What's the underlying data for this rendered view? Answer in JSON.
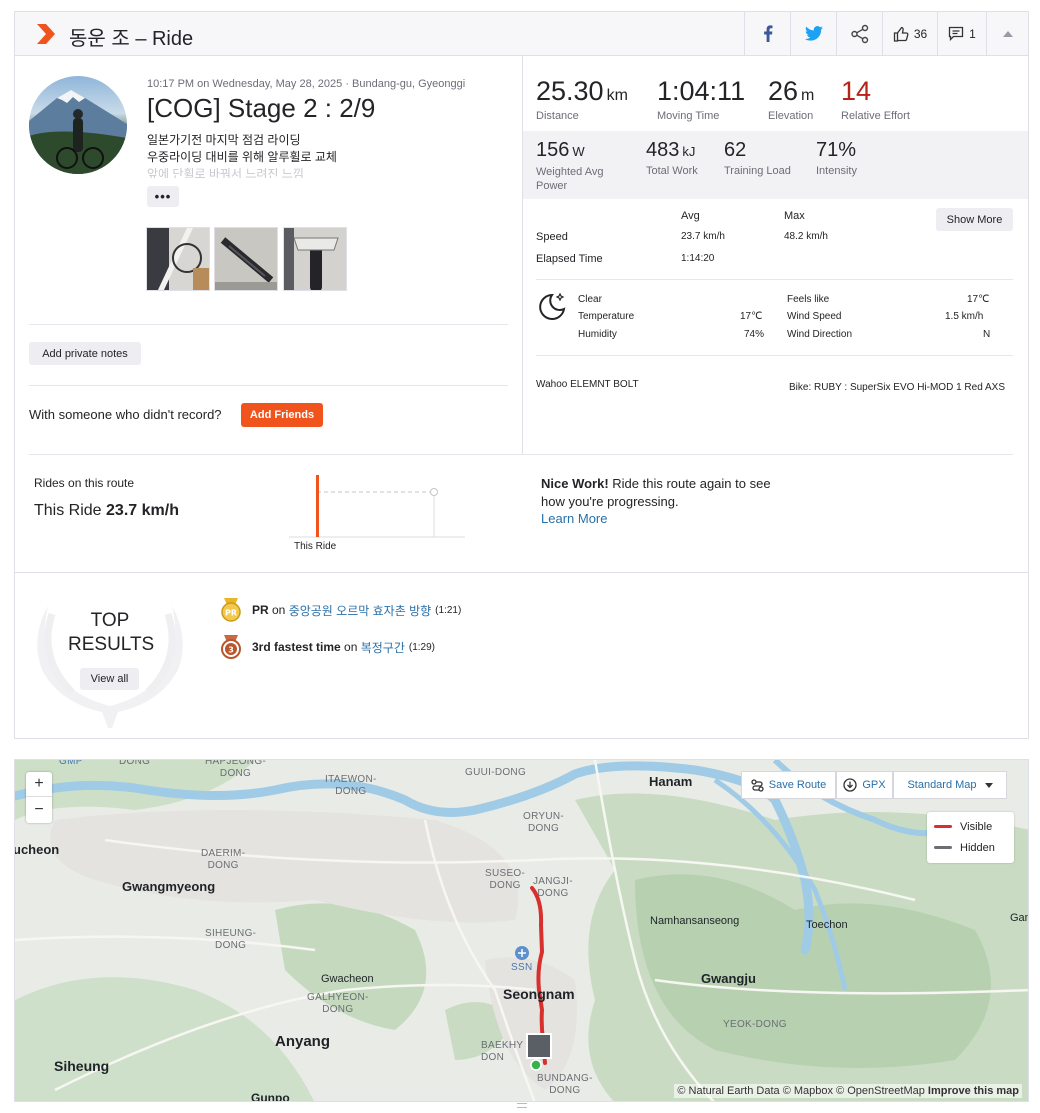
{
  "header": {
    "title": "동운 조 – Ride",
    "kudos_count": "36",
    "comments_count": "1"
  },
  "activity": {
    "meta": "10:17 PM on Wednesday, May 28, 2025 · Bundang-gu, Gyeonggi",
    "title": "[COG] Stage 2 : 2/9",
    "description_lines": [
      "일본가기전 마지막 점검 라이딩",
      "우중라이딩 대비를 위해 알루휠로 교체",
      "앞에 단휠로 바꿔서 느려진 느낌"
    ],
    "more_label": "•••",
    "add_notes_label": "Add private notes",
    "friends_prompt": "With someone who didn't record?",
    "add_friends_label": "Add Friends"
  },
  "stats_primary": [
    {
      "value": "25.30",
      "unit": "km",
      "label": "Distance"
    },
    {
      "value": "1:04:11",
      "unit": "",
      "label": "Moving Time"
    },
    {
      "value": "26",
      "unit": "m",
      "label": "Elevation"
    },
    {
      "value": "14",
      "unit": "",
      "label": "Relative Effort"
    }
  ],
  "stats_secondary": [
    {
      "value": "156",
      "unit": "W",
      "label": "Weighted Avg Power"
    },
    {
      "value": "483",
      "unit": "kJ",
      "label": "Total Work"
    },
    {
      "value": "62",
      "unit": "",
      "label": "Training Load"
    },
    {
      "value": "71%",
      "unit": "",
      "label": "Intensity"
    }
  ],
  "details": {
    "col_avg": "Avg",
    "col_max": "Max",
    "show_more_label": "Show More",
    "speed_label": "Speed",
    "speed_avg": "23.7 km/h",
    "speed_max": "48.2 km/h",
    "elapsed_label": "Elapsed Time",
    "elapsed_value": "1:14:20"
  },
  "weather": {
    "condition": "Clear",
    "temperature_label": "Temperature",
    "temperature": "17℃",
    "humidity_label": "Humidity",
    "humidity": "74%",
    "feels_like_label": "Feels like",
    "feels_like": "17℃",
    "wind_speed_label": "Wind Speed",
    "wind_speed": "1.5 km/h",
    "wind_direction_label": "Wind Direction",
    "wind_direction": "N"
  },
  "gear": {
    "device": "Wahoo ELEMNT BOLT",
    "bike": "Bike: RUBY : SuperSix EVO Hi-MOD 1 Red AXS"
  },
  "route_compare": {
    "label": "Rides on this route",
    "this_ride_prefix": "This Ride ",
    "this_ride_value": "23.7 km/h",
    "axis_label": "This Ride",
    "nice_work": "Nice Work!",
    "nice_text": " Ride this route again to see how you're progressing.",
    "learn_more": "Learn More"
  },
  "top_results": {
    "title_line1": "TOP",
    "title_line2": "RESULTS",
    "view_all": "View all",
    "items": [
      {
        "badge": "PR",
        "strong": "PR",
        "on": " on ",
        "segment": "중앙공원 오르막 효자촌 방향",
        "time": "(1:21)"
      },
      {
        "badge": "3",
        "strong": "3rd fastest time",
        "on": " on ",
        "segment": "복정구간",
        "time": "(1:29)"
      }
    ]
  },
  "map": {
    "save_route": "Save Route",
    "gpx": "GPX",
    "map_style": "Standard Map",
    "legend_visible": "Visible",
    "legend_hidden": "Hidden",
    "zoom_in": "+",
    "zoom_out": "−",
    "attribution": "© Natural Earth Data © Mapbox © OpenStreetMap ",
    "improve": "Improve this map",
    "route_color": "#d8302f",
    "hidden_color": "#6d6d78",
    "labels": {
      "gmp": "GMP",
      "dong": "DONG",
      "hapjeong": "HAPJEONG-\nDONG",
      "itaewon": "ITAEWON-\nDONG",
      "guui": "GUUI-DONG",
      "hanam": "Hanam",
      "oryun": "ORYUN-\nDONG",
      "bucheon": "ucheon",
      "daerim": "DAERIM-\nDONG",
      "gwangmyeong": "Gwangmyeong",
      "suseo": "SUSEO-\nDONG",
      "jangji": "JANGJI-\nDONG",
      "namhansanseong": "Namhansanseong",
      "toechon": "Toechon",
      "gam": "Gam",
      "siheung_dong": "SIHEUNG-\nDONG",
      "ssn": "SSN",
      "gwacheon": "Gwacheon",
      "gwangju": "Gwangju",
      "galhyeon": "GALHYEON-\nDONG",
      "seongnam": "Seongnam",
      "yeok": "YEOK-DONG",
      "anyang": "Anyang",
      "baekhyeon": "BAEKHY\nDON",
      "siheung": "Siheung",
      "bundang": "BUNDANG-\nDONG",
      "gunpo": "Gunpo"
    }
  }
}
